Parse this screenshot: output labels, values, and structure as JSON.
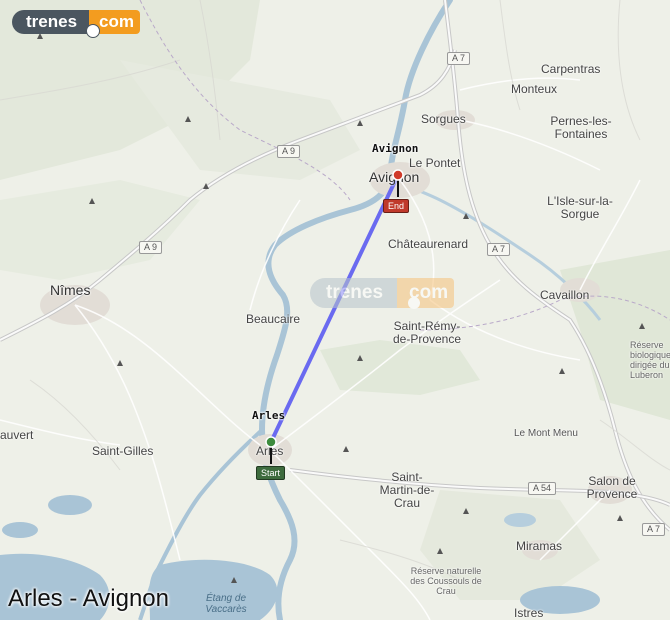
{
  "logo": {
    "part1": "trenes",
    "part2": "com"
  },
  "watermark": {
    "part1": "trenes",
    "part2": "com"
  },
  "route": {
    "title": "Arles - Avignon",
    "origin_label": "Arles",
    "destination_label": "Avignon",
    "start_tag": "Start",
    "end_tag": "End",
    "line_color": "#6a6af0"
  },
  "colors": {
    "water": "#a9c4d6",
    "land": "#eef0e8",
    "start_marker": "#3d8b3d",
    "end_marker": "#d03a2a"
  },
  "places": {
    "nimes": "Nîmes",
    "avignon": "Avignon",
    "arles": "Arles",
    "sorgues": "Sorgues",
    "le_pontet": "Le Pontet",
    "carpentras": "Carpentras",
    "monteux": "Monteux",
    "pernes": "Pernes-les-Fontaines",
    "isle": "L'Isle-sur-la-Sorgue",
    "chateaurenard": "Châteaurenard",
    "cavaillon": "Cavaillon",
    "beaucaire": "Beaucaire",
    "saint_remy": "Saint-Rémy-de-Provence",
    "saint_gilles": "Saint-Gilles",
    "vauvert": "auvert",
    "le_mont_menu": "Le Mont Menu",
    "saint_martin": "Saint-Martin-de-Crau",
    "salon": "Salon de Provence",
    "miramas": "Miramas",
    "istres": "Istres",
    "reserve_coussouls": "Réserve naturelle des Coussouls de Crau",
    "reserve_luberon": "Réserve biologique dirigée du Luberon",
    "etang": "Étang de Vaccarès"
  },
  "roads": {
    "a7": "A 7",
    "a9": "A 9",
    "a54": "A 54"
  }
}
